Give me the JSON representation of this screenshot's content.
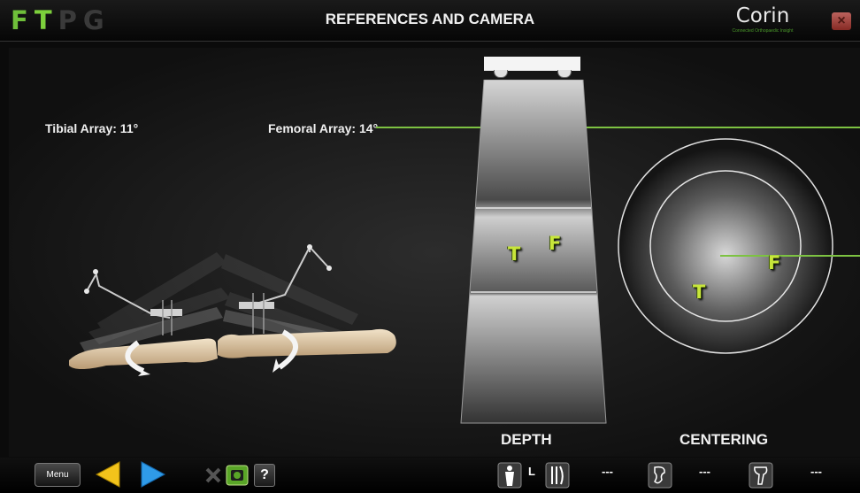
{
  "header": {
    "mode_letters": [
      {
        "letter": "F",
        "color": "#6fbf3a"
      },
      {
        "letter": "T",
        "color": "#7dd03c"
      },
      {
        "letter": "P",
        "color": "#3a3a3a"
      },
      {
        "letter": "G",
        "color": "#3a3a3a"
      }
    ],
    "title": "REFERENCES AND CAMERA",
    "logo_name": "Corin",
    "logo_tagline": "Connected Orthopaedic Insight",
    "close_label": "×"
  },
  "arrays": {
    "tibial_label": "Tibial Array: 11°",
    "femoral_label": "Femoral Array: 14°"
  },
  "depth": {
    "label": "DEPTH",
    "tibia_marker": "T",
    "femur_marker": "F"
  },
  "centering": {
    "label": "CENTERING",
    "tibia_marker": "T",
    "femur_marker": "F"
  },
  "bottom": {
    "menu_label": "Menu",
    "help_label": "?",
    "side_label": "L",
    "status_values": [
      "---",
      "---",
      "---"
    ]
  },
  "colors": {
    "accent_green": "#7dc242",
    "marker_yellow": "#c8e63a",
    "nav_yellow": "#f2c31b",
    "nav_blue": "#2f9be8"
  }
}
